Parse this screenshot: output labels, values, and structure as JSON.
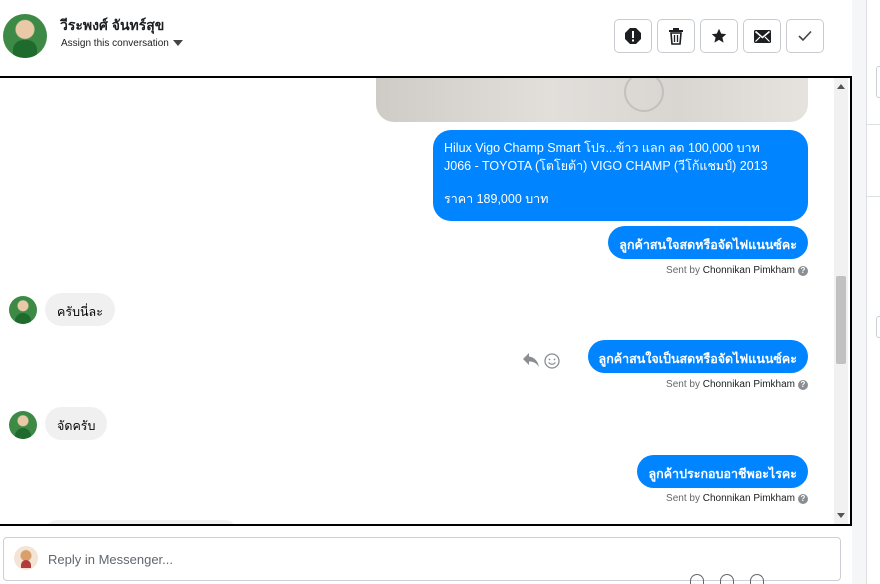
{
  "header": {
    "contact_name": "วีระพงศ์ จันทร์สุข",
    "assign_label": "Assign this conversation",
    "toolbar": {
      "spam": "spam-alert-icon",
      "delete": "trash-icon",
      "star": "star-icon",
      "unread": "envelope-icon",
      "done": "checkmark-icon"
    }
  },
  "messages": [
    {
      "direction": "out",
      "line1": "Hilux Vigo Champ Smart โปร...ข้าว แลก ลด 100,000 บาท",
      "line2": "J066 - TOYOTA (โตโยต้า) VIGO CHAMP (วีโก้แชมป์) 2013",
      "line3": "ราคา 189,000 บาท"
    },
    {
      "direction": "out",
      "text": "ลูกค้าสนใจสดหรือจัดไฟแนนซ์คะ"
    },
    {
      "direction": "in",
      "text": "ครับนี่ละ"
    },
    {
      "direction": "out",
      "text": "ลูกค้าสนใจเป็นสดหรือจัดไฟแนนซ์คะ"
    },
    {
      "direction": "in",
      "text": "จัดครับ"
    },
    {
      "direction": "out",
      "text": "ลูกค้าประกอบอาชีพอะไรคะ"
    }
  ],
  "sent_by": {
    "prefix": "Sent by",
    "name": "Chonnikan Pimkham"
  },
  "reply": {
    "placeholder": "Reply in Messenger..."
  },
  "colors": {
    "outgoing_bubble": "#0084ff",
    "incoming_bubble": "#f0f0f0"
  }
}
